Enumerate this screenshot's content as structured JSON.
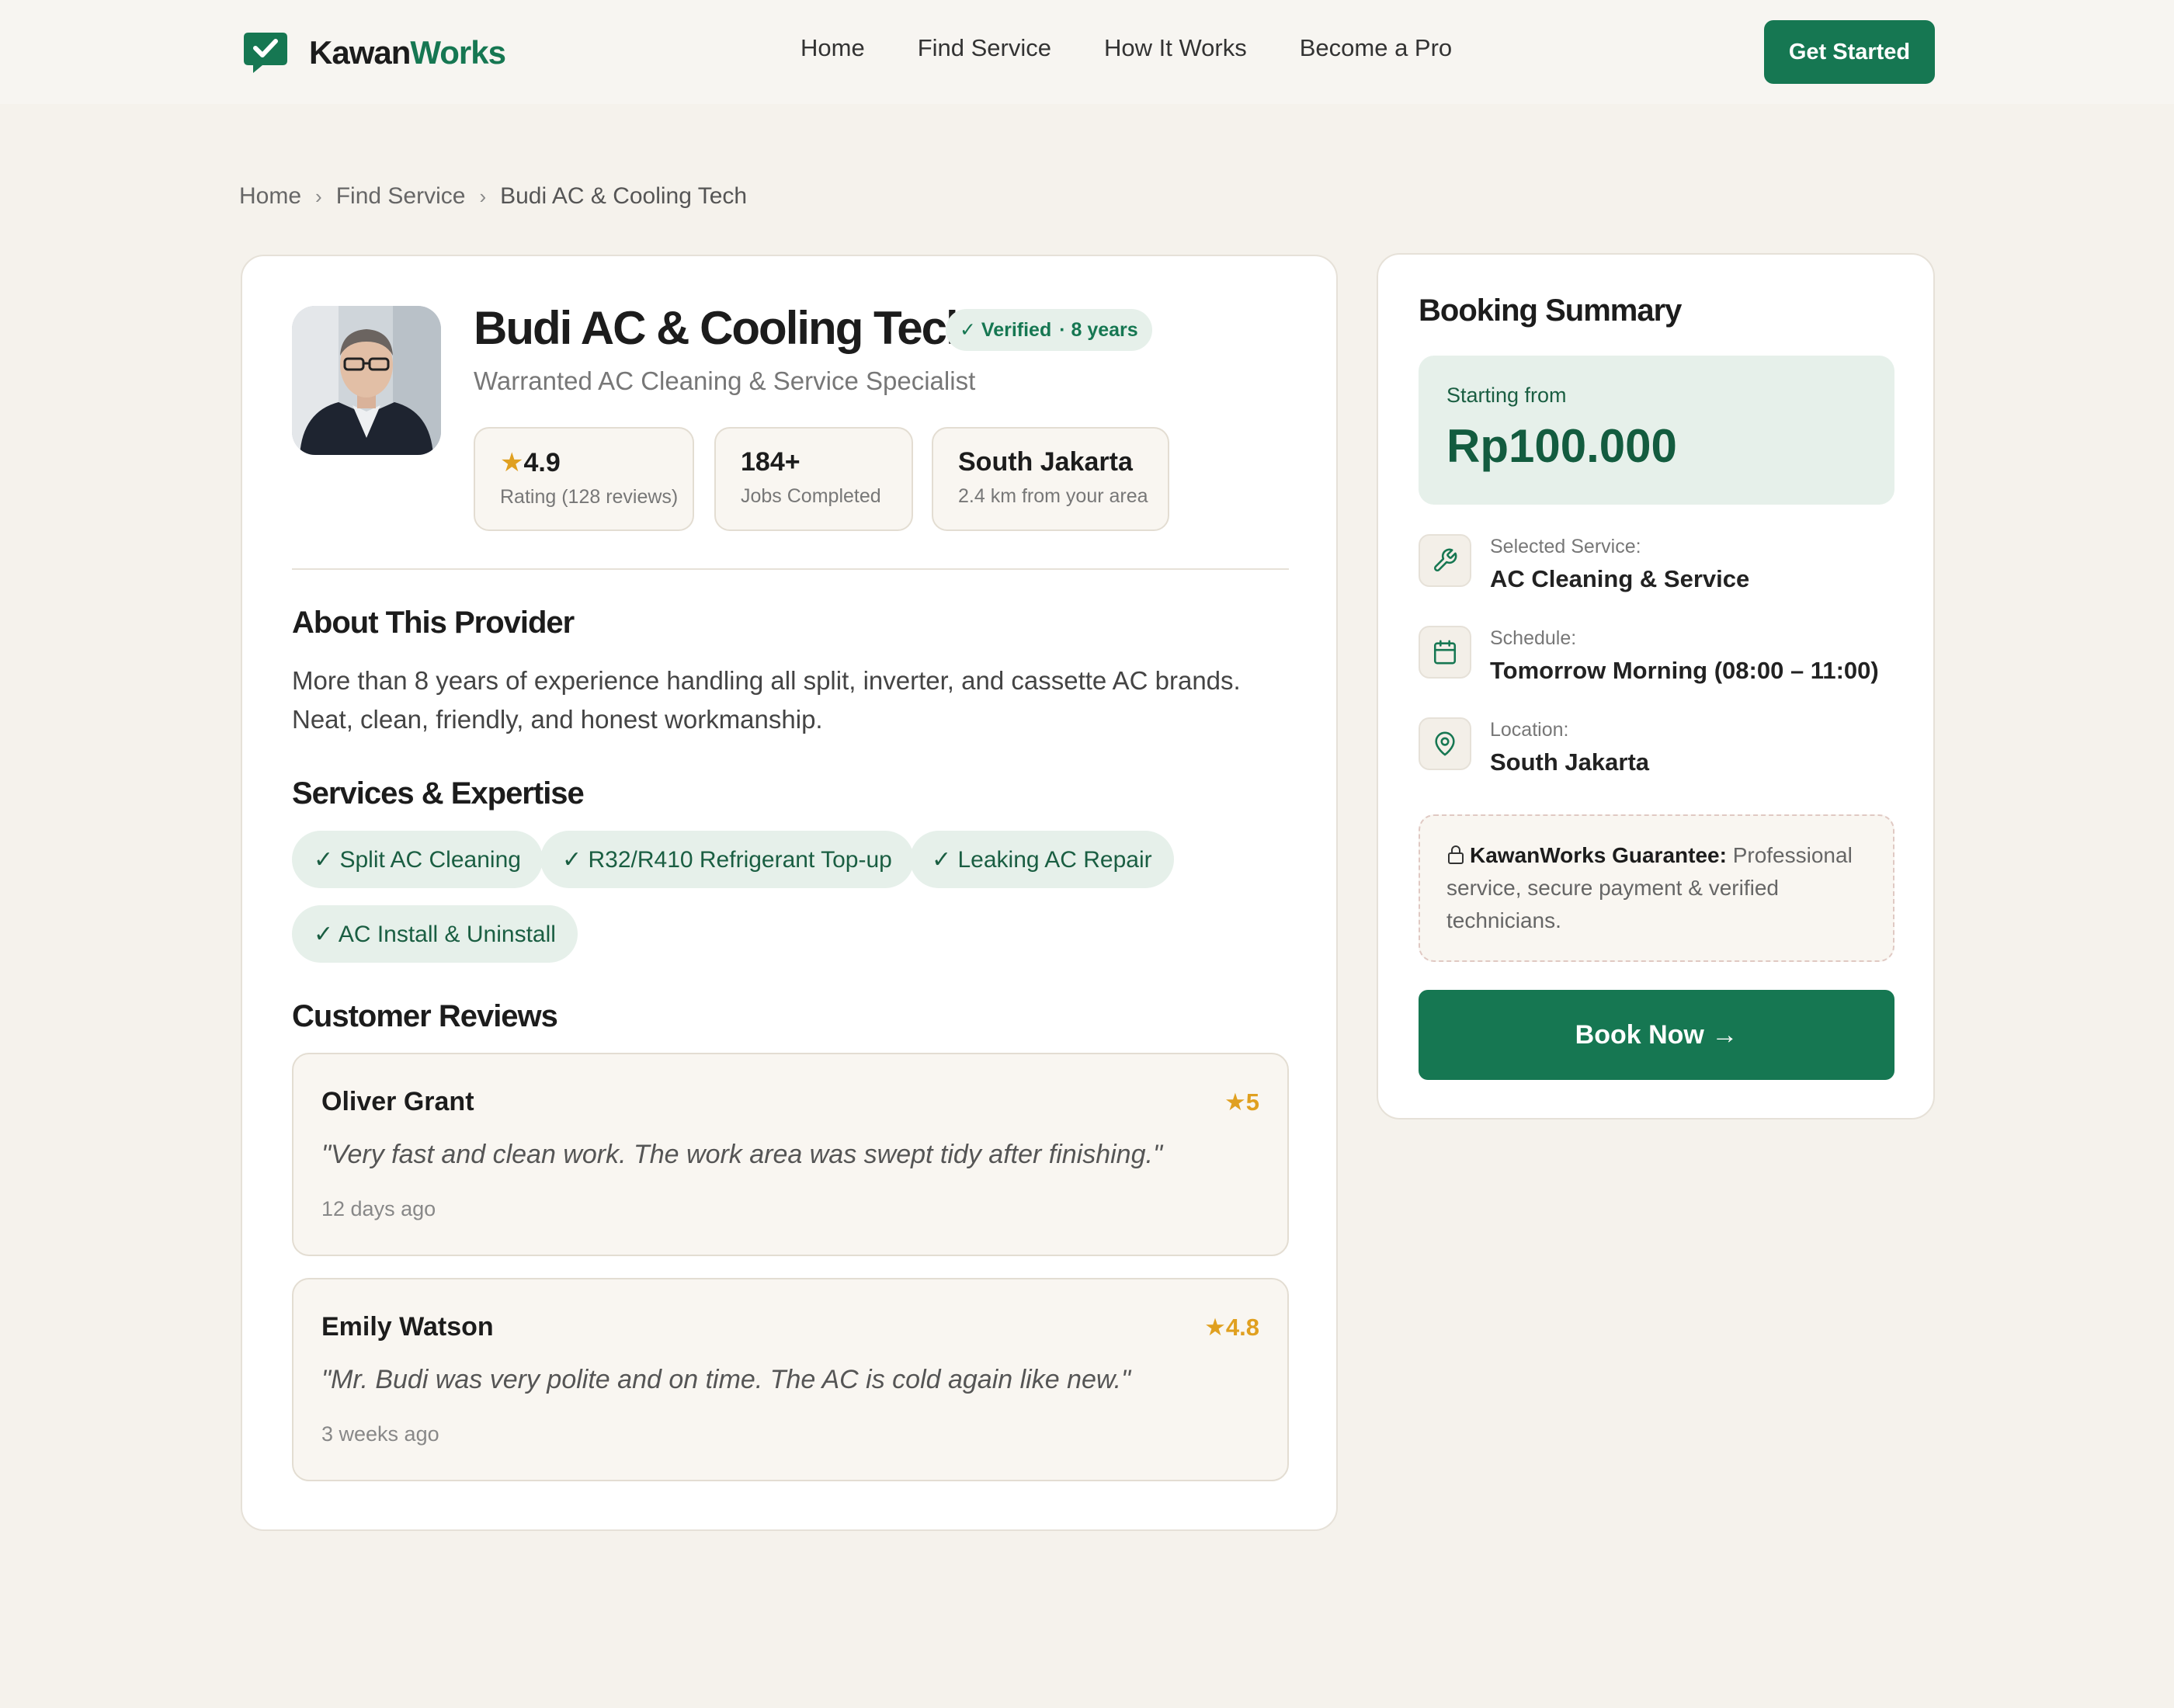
{
  "brand": {
    "name_part1": "Kawan",
    "name_part2": "Works",
    "accent": "#167752"
  },
  "nav": {
    "links": [
      "Home",
      "Find Service",
      "How It Works",
      "Become a Pro"
    ],
    "cta": "Get Started"
  },
  "breadcrumb": {
    "items": [
      "Home",
      "Find Service",
      "Budi AC & Cooling Tech"
    ],
    "separator": "›"
  },
  "provider": {
    "name": "Budi AC & Cooling Tech",
    "badge_verified": "✓ Verified",
    "badge_years": "· 8  years",
    "subtitle": "Warranted AC Cleaning & Service Specialist",
    "stats": [
      {
        "star": "★",
        "value": "4.9",
        "label": "Rating (128 reviews)"
      },
      {
        "value": "184+",
        "label": "Jobs Completed"
      },
      {
        "value": "South Jakarta",
        "label": "2.4 km from your area"
      }
    ]
  },
  "about": {
    "heading": "About This Provider",
    "text": "More than 8 years of experience handling all split, inverter, and cassette AC brands. Neat, clean, friendly, and honest workmanship."
  },
  "services": {
    "heading": "Services & Expertise",
    "items": [
      "✓ Split AC Cleaning",
      "✓ R32/R410 Refrigerant Top-up",
      "✓ Leaking AC Repair",
      "✓ AC Install & Uninstall"
    ]
  },
  "reviews": {
    "heading": "Customer Reviews",
    "items": [
      {
        "name": "Oliver Grant",
        "rating": "★5",
        "text": "\"Very fast and clean work. The work area was swept tidy after finishing.\"",
        "date": "12 days ago"
      },
      {
        "name": "Emily Watson",
        "rating": "★4.8",
        "text": "\"Mr. Budi was very polite and on time. The AC is cold again like new.\"",
        "date": "3 weeks ago"
      }
    ]
  },
  "booking": {
    "title": "Booking Summary",
    "price_label": "Starting from",
    "price": "Rp100.000",
    "details": [
      {
        "icon": "wrench-icon",
        "label": "Selected Service:",
        "value": "AC Cleaning & Service"
      },
      {
        "icon": "calendar-icon",
        "label": "Schedule:",
        "value": "Tomorrow Morning (08:00 – 11:00)"
      },
      {
        "icon": "location-pin-icon",
        "label": "Location:",
        "value": "South Jakarta"
      }
    ],
    "guarantee_title": "KawanWorks Guarantee:",
    "guarantee_text": " Professional service, secure payment & verified technicians.",
    "button": "Book Now →"
  }
}
